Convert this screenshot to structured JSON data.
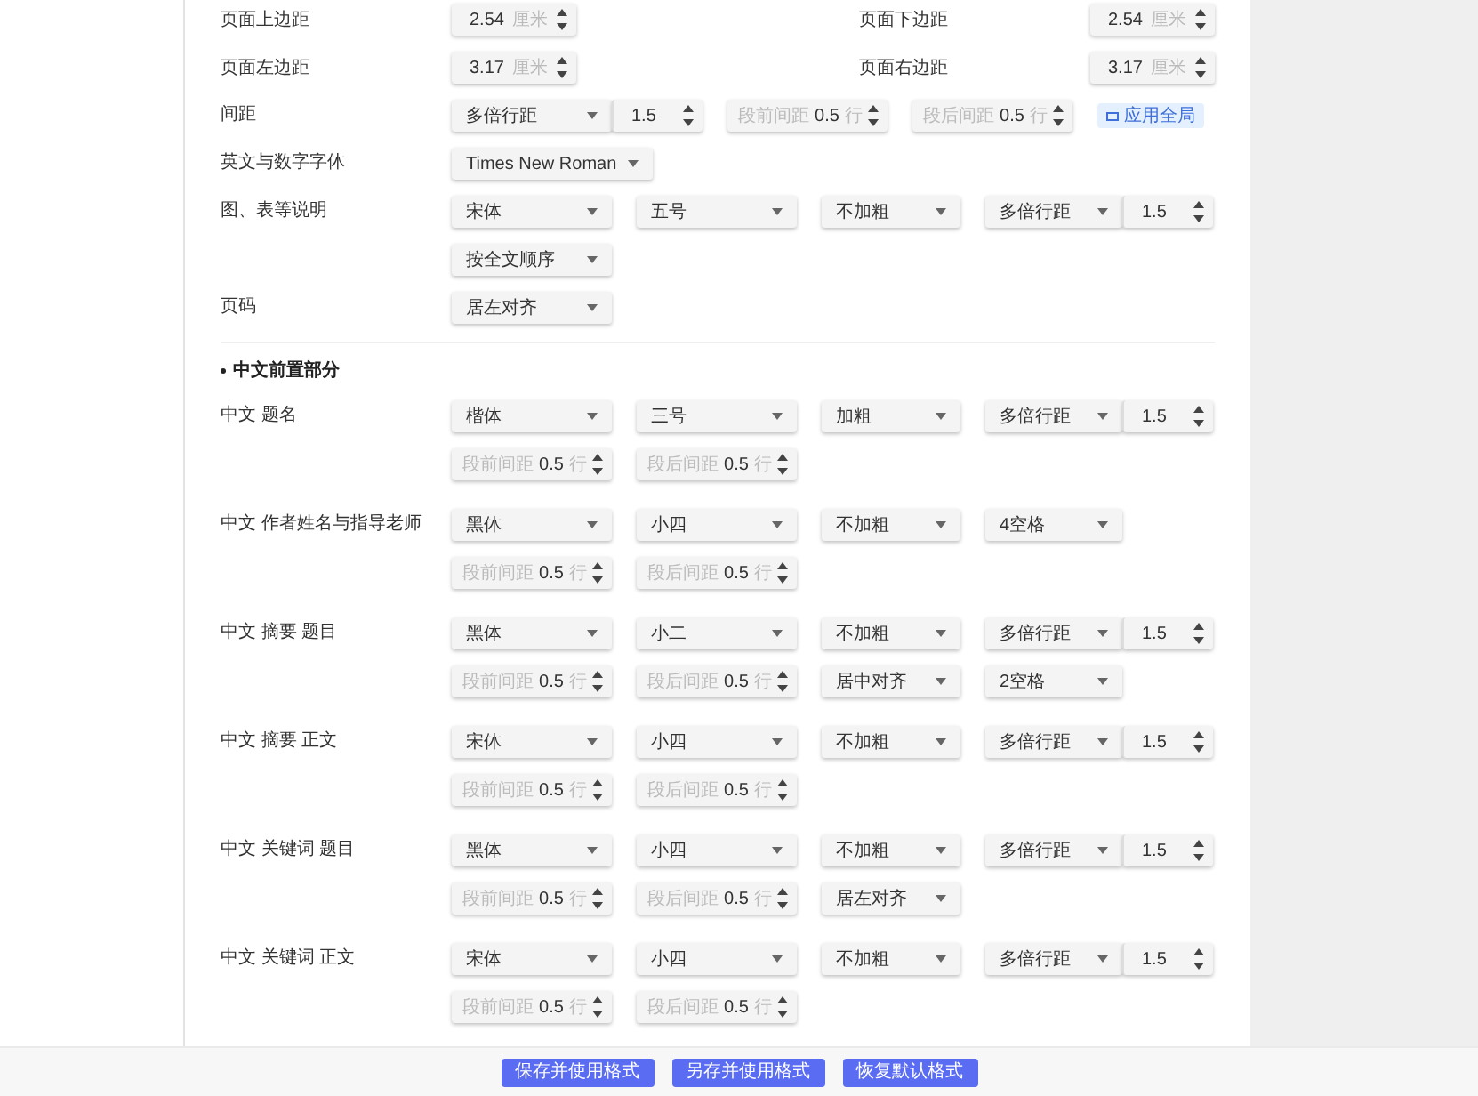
{
  "general_rows": [
    {
      "kind": "pair",
      "items": [
        {
          "label": "页面上边距",
          "control": {
            "kind": "spinner",
            "value": "2.54",
            "unit": "厘米"
          }
        },
        {
          "label": "页面下边距",
          "control": {
            "kind": "spinner",
            "value": "2.54",
            "unit": "厘米"
          }
        }
      ]
    },
    {
      "kind": "pair",
      "items": [
        {
          "label": "页面左边距",
          "control": {
            "kind": "spinner",
            "value": "3.17",
            "unit": "厘米"
          }
        },
        {
          "label": "页面右边距",
          "control": {
            "kind": "spinner",
            "value": "3.17",
            "unit": "厘米"
          }
        }
      ]
    },
    {
      "kind": "normal",
      "label": "间距",
      "lines": [
        [
          {
            "kind": "line_spacing",
            "value": "多倍行距",
            "number": "1.5"
          },
          {
            "kind": "spacing",
            "prefix": "段前间距",
            "value": "0.5",
            "unit": "行"
          },
          {
            "kind": "spacing",
            "prefix": "段后间距",
            "value": "0.5",
            "unit": "行"
          },
          {
            "kind": "action",
            "label": "应用全局"
          }
        ]
      ]
    },
    {
      "kind": "normal",
      "label": "英文与数字字体",
      "lines": [
        [
          {
            "kind": "select",
            "value": "Times New Roman"
          }
        ]
      ]
    },
    {
      "kind": "normal",
      "label": "图、表等说明",
      "lines": [
        [
          {
            "kind": "select",
            "value": "宋体"
          },
          {
            "kind": "select",
            "value": "五号"
          },
          {
            "kind": "select",
            "value": "不加粗"
          },
          {
            "kind": "line_spacing",
            "value": "多倍行距",
            "number": "1.5"
          }
        ],
        [
          {
            "kind": "select",
            "value": "按全文顺序"
          }
        ]
      ]
    },
    {
      "kind": "normal",
      "label": "页码",
      "lines": [
        [
          {
            "kind": "select",
            "value": "居左对齐"
          }
        ]
      ]
    }
  ],
  "section": {
    "heading": "中文前置部分",
    "rows": [
      {
        "label": "中文 题名",
        "lines": [
          [
            {
              "kind": "select",
              "value": "楷体"
            },
            {
              "kind": "select",
              "value": "三号"
            },
            {
              "kind": "select",
              "value": "加粗"
            },
            {
              "kind": "line_spacing",
              "value": "多倍行距",
              "number": "1.5"
            }
          ],
          [
            {
              "kind": "spacing",
              "prefix": "段前间距",
              "value": "0.5",
              "unit": "行"
            },
            {
              "kind": "spacing",
              "prefix": "段后间距",
              "value": "0.5",
              "unit": "行"
            }
          ]
        ]
      },
      {
        "label": "中文 作者姓名与指导老师",
        "lines": [
          [
            {
              "kind": "select",
              "value": "黑体"
            },
            {
              "kind": "select",
              "value": "小四"
            },
            {
              "kind": "select",
              "value": "不加粗"
            },
            {
              "kind": "select",
              "value": "4空格"
            }
          ],
          [
            {
              "kind": "spacing",
              "prefix": "段前间距",
              "value": "0.5",
              "unit": "行"
            },
            {
              "kind": "spacing",
              "prefix": "段后间距",
              "value": "0.5",
              "unit": "行"
            }
          ]
        ]
      },
      {
        "label": "中文 摘要 题目",
        "lines": [
          [
            {
              "kind": "select",
              "value": "黑体"
            },
            {
              "kind": "select",
              "value": "小二"
            },
            {
              "kind": "select",
              "value": "不加粗"
            },
            {
              "kind": "line_spacing",
              "value": "多倍行距",
              "number": "1.5"
            }
          ],
          [
            {
              "kind": "spacing",
              "prefix": "段前间距",
              "value": "0.5",
              "unit": "行"
            },
            {
              "kind": "spacing",
              "prefix": "段后间距",
              "value": "0.5",
              "unit": "行"
            },
            {
              "kind": "select",
              "value": "居中对齐"
            },
            {
              "kind": "select",
              "value": "2空格"
            }
          ]
        ]
      },
      {
        "label": "中文 摘要 正文",
        "lines": [
          [
            {
              "kind": "select",
              "value": "宋体"
            },
            {
              "kind": "select",
              "value": "小四"
            },
            {
              "kind": "select",
              "value": "不加粗"
            },
            {
              "kind": "line_spacing",
              "value": "多倍行距",
              "number": "1.5"
            }
          ],
          [
            {
              "kind": "spacing",
              "prefix": "段前间距",
              "value": "0.5",
              "unit": "行"
            },
            {
              "kind": "spacing",
              "prefix": "段后间距",
              "value": "0.5",
              "unit": "行"
            }
          ]
        ]
      },
      {
        "label": "中文 关键词 题目",
        "lines": [
          [
            {
              "kind": "select",
              "value": "黑体"
            },
            {
              "kind": "select",
              "value": "小四"
            },
            {
              "kind": "select",
              "value": "不加粗"
            },
            {
              "kind": "line_spacing",
              "value": "多倍行距",
              "number": "1.5"
            }
          ],
          [
            {
              "kind": "spacing",
              "prefix": "段前间距",
              "value": "0.5",
              "unit": "行"
            },
            {
              "kind": "spacing",
              "prefix": "段后间距",
              "value": "0.5",
              "unit": "行"
            },
            {
              "kind": "select",
              "value": "居左对齐"
            }
          ]
        ]
      },
      {
        "label": "中文 关键词 正文",
        "lines": [
          [
            {
              "kind": "select",
              "value": "宋体"
            },
            {
              "kind": "select",
              "value": "小四"
            },
            {
              "kind": "select",
              "value": "不加粗"
            },
            {
              "kind": "line_spacing",
              "value": "多倍行距",
              "number": "1.5"
            }
          ],
          [
            {
              "kind": "spacing",
              "prefix": "段前间距",
              "value": "0.5",
              "unit": "行"
            },
            {
              "kind": "spacing",
              "prefix": "段后间距",
              "value": "0.5",
              "unit": "行"
            }
          ]
        ]
      }
    ]
  },
  "footer_buttons": [
    "保存并使用格式",
    "另存并使用格式",
    "恢复默认格式"
  ]
}
